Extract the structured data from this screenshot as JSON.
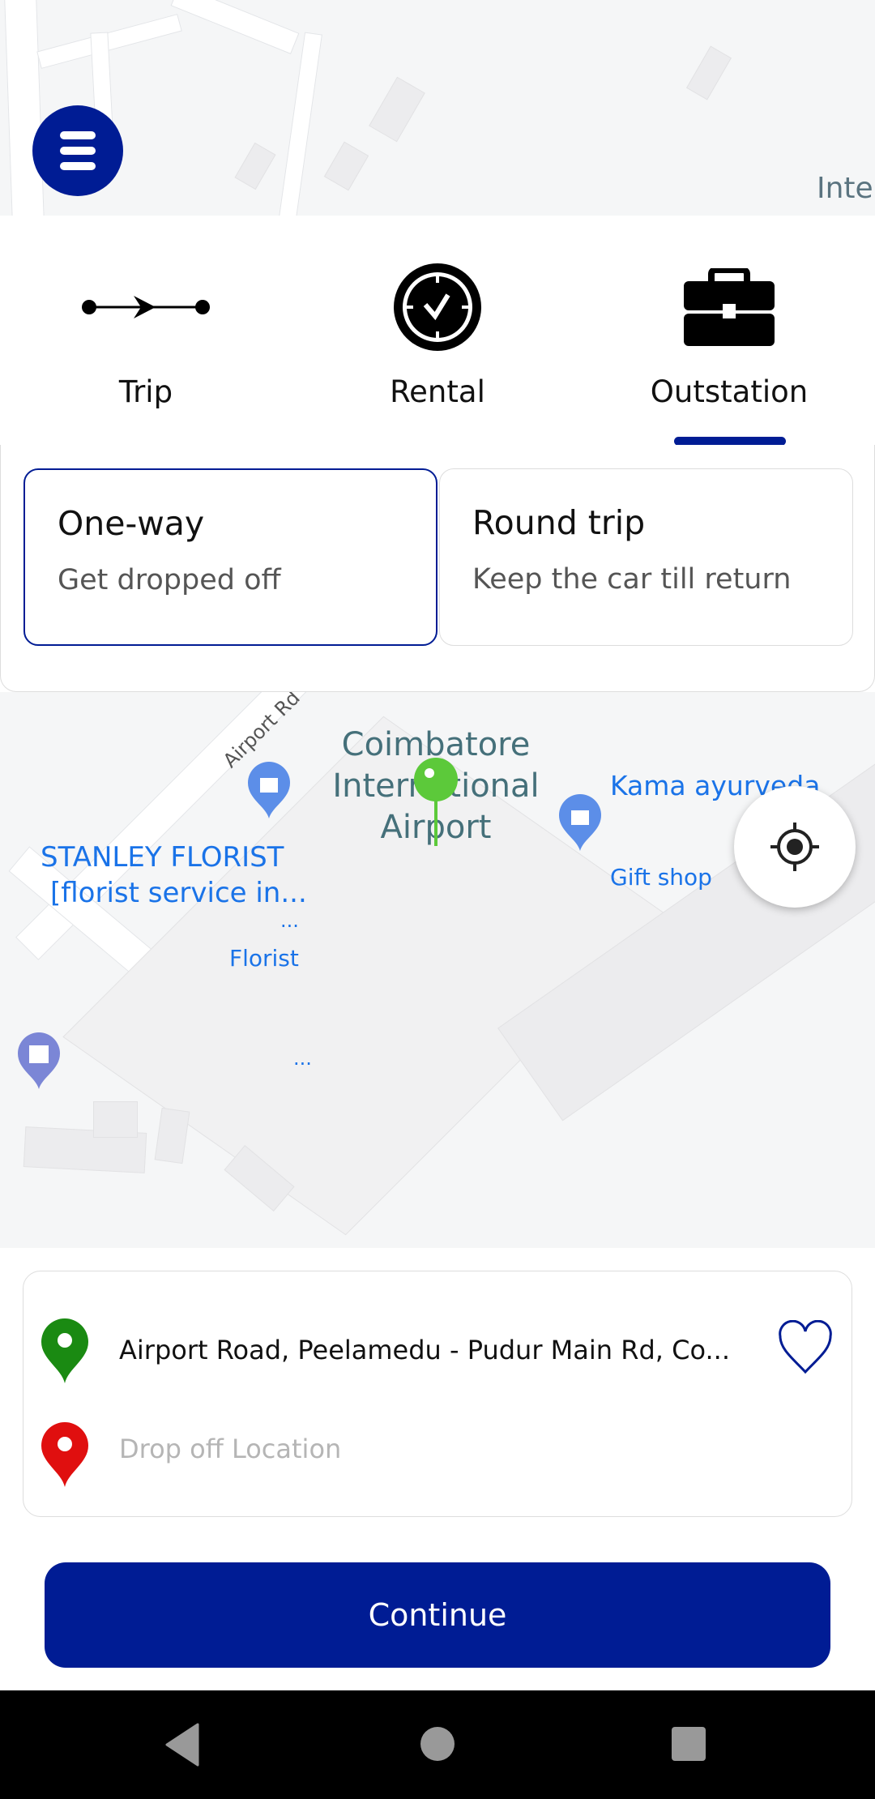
{
  "menu": {
    "icon": "hamburger-menu-icon"
  },
  "tabs": [
    {
      "label": "Trip",
      "icon": "route-arrow-icon"
    },
    {
      "label": "Rental",
      "icon": "clock-icon"
    },
    {
      "label": "Outstation",
      "icon": "briefcase-icon",
      "selected": true
    }
  ],
  "trip_options": [
    {
      "title": "One-way",
      "subtitle": "Get dropped off",
      "selected": true
    },
    {
      "title": "Round trip",
      "subtitle": "Keep the car till return",
      "selected": false
    }
  ],
  "map": {
    "labels": {
      "road": "Airport Rd",
      "airport_line1": "Coimbatore",
      "airport_line2": "International",
      "airport_line3": "Airport",
      "kama": "Kama ayurveda",
      "gift": "Gift shop",
      "florist_line1": "STANLEY FLORIST",
      "florist_line2": "[florist service in...",
      "florist_more": "...",
      "florist_type": "Florist",
      "more2": "...",
      "inter": "Inter"
    }
  },
  "location": {
    "pickup": "Airport Road, Peelamedu - Pudur Main Rd, Co...",
    "drop_placeholder": "Drop off Location"
  },
  "continue_label": "Continue",
  "colors": {
    "primary": "#001c94",
    "pickup_pin": "#1a8a12",
    "drop_pin": "#e00f0f",
    "map_pin": "#5cc93a",
    "poi_blue": "#1a73e8"
  }
}
